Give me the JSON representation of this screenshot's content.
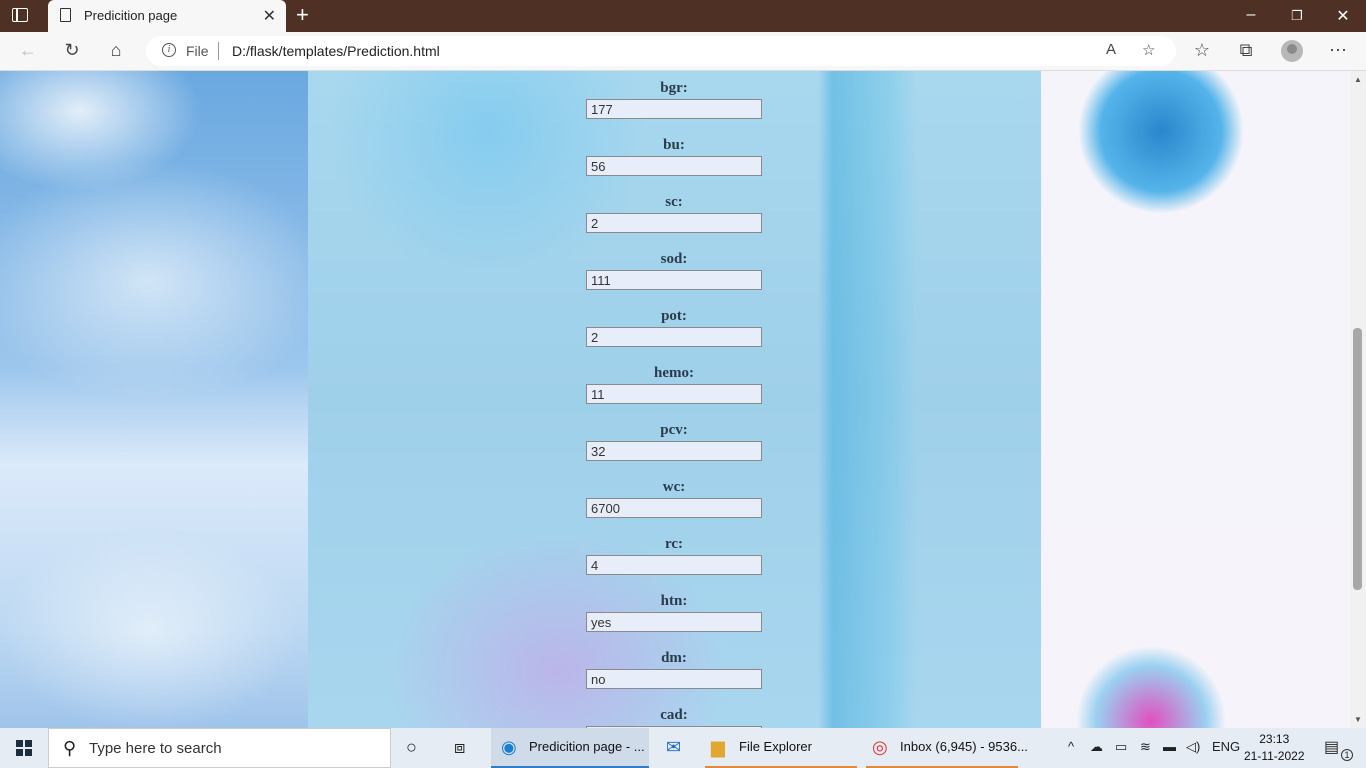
{
  "browser": {
    "tab_title": "Predicition page",
    "address": {
      "protocol_label": "File",
      "url": "D:/flask/templates/Prediction.html"
    }
  },
  "form_fields": [
    {
      "label": "bgr:",
      "value": "177"
    },
    {
      "label": "bu:",
      "value": "56"
    },
    {
      "label": "sc:",
      "value": "2"
    },
    {
      "label": "sod:",
      "value": "111"
    },
    {
      "label": "pot:",
      "value": "2"
    },
    {
      "label": "hemo:",
      "value": "11"
    },
    {
      "label": "pcv:",
      "value": "32"
    },
    {
      "label": "wc:",
      "value": "6700"
    },
    {
      "label": "rc:",
      "value": "4"
    },
    {
      "label": "htn:",
      "value": "yes"
    },
    {
      "label": "dm:",
      "value": "no"
    },
    {
      "label": "cad:",
      "value": ""
    }
  ],
  "taskbar": {
    "search_placeholder": "Type here to search",
    "apps": [
      {
        "label": "Predicition page - ..."
      },
      {
        "label": "File Explorer"
      },
      {
        "label": "Inbox (6,945) - 9536..."
      }
    ],
    "language": "ENG",
    "time": "23:13",
    "date": "21-11-2022",
    "notification_count": "1"
  },
  "colors": {
    "titlebar": "#4e3025",
    "input_bg": "#e8eef9",
    "label": "#2a3c4c"
  }
}
